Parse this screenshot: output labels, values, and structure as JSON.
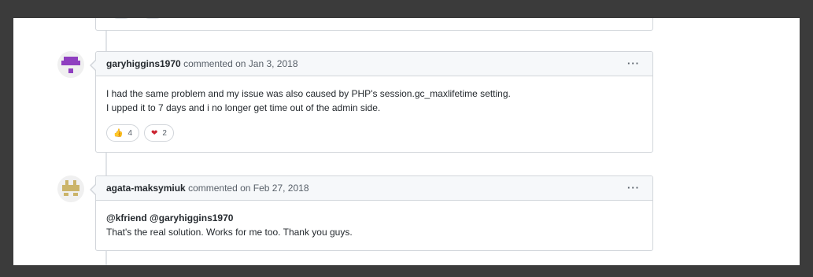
{
  "comments": [
    {
      "author": "garyhiggins1970",
      "meta": "commented on Jan 3, 2018",
      "menu": "···",
      "lines": [
        "I had the same problem and my issue was also caused by PHP's session.gc_maxlifetime setting.",
        "I upped it to 7 days and i no longer get time out of the admin side."
      ],
      "reactions": [
        {
          "emoji": "👍",
          "count": "4"
        },
        {
          "emoji": "❤",
          "count": "2"
        }
      ]
    },
    {
      "author": "agata-maksymiuk",
      "meta": "commented on Feb 27, 2018",
      "menu": "···",
      "mention": "@kfriend @garyhiggins1970",
      "lines": [
        "That's the real solution. Works for me too. Thank you guys."
      ]
    }
  ],
  "colors": {
    "avatar1": "#8f3fc0",
    "avatar2": "#cbb46a"
  }
}
